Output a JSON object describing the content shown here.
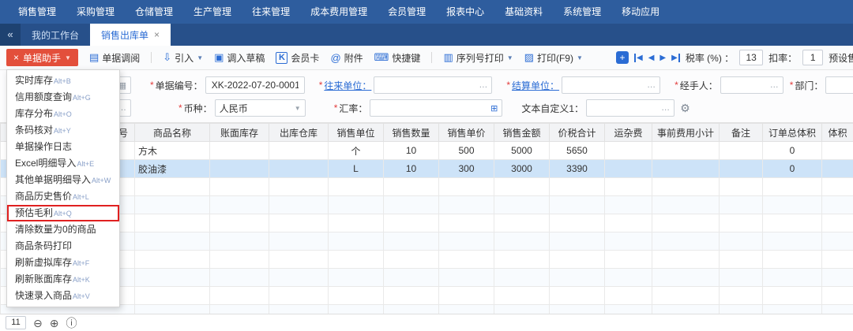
{
  "colors": {
    "navbar": "#2e5d9e",
    "tabbar": "#27508a",
    "accent_red": "#e34f3b",
    "link_blue": "#2b6cd4",
    "selected_row": "#cde3f8",
    "highlight_red": "#e02020"
  },
  "icons": {
    "back-icon": "«",
    "close-icon": "×",
    "caret-down-icon": "▼",
    "assistant-icon": "×",
    "doc-view-icon": "▤",
    "import-icon": "⇩",
    "draft-icon": "▣",
    "member-card-icon": "K",
    "attachment-icon": "@",
    "hotkey-icon": "⌨",
    "serial-print-icon": "▥",
    "print-icon": "▨",
    "add-icon": "+",
    "first-page-icon": "◀",
    "prev-icon": "◀",
    "next-icon": "▶",
    "last-page-icon": "▶",
    "calendar-icon": "▦",
    "ellipsis-icon": "…",
    "exrate-grid-icon": "⊞",
    "gear-icon": "⚙",
    "minus-circle-icon": "⊖",
    "plus-circle-icon": "⊕",
    "info-circle-icon": "ⓘ"
  },
  "nav": {
    "items": [
      "销售管理",
      "采购管理",
      "仓储管理",
      "生产管理",
      "往来管理",
      "成本费用管理",
      "会员管理",
      "报表中心",
      "基础资料",
      "系统管理",
      "移动应用"
    ]
  },
  "tabs": {
    "items": [
      {
        "label": "我的工作台",
        "active": false,
        "closable": false
      },
      {
        "label": "销售出库单",
        "active": true,
        "closable": true
      }
    ]
  },
  "toolbar": {
    "assistant_label": "单据助手",
    "buttons": [
      {
        "label": "单据调阅",
        "icon": "doc-view-icon",
        "caret": false
      },
      {
        "label": "引入",
        "icon": "import-icon",
        "caret": true
      },
      {
        "label": "调入草稿",
        "icon": "draft-icon",
        "caret": false
      },
      {
        "label": "会员卡",
        "icon": "member-card-icon",
        "caret": false
      },
      {
        "label": "附件",
        "icon": "attachment-icon",
        "caret": false
      },
      {
        "label": "快捷键",
        "icon": "hotkey-icon",
        "caret": false
      },
      {
        "label": "序列号打印",
        "icon": "serial-print-icon",
        "caret": true
      },
      {
        "label": "打印(F9)",
        "icon": "print-icon",
        "caret": true
      }
    ],
    "tax_rate_label": "税率 (%) ：",
    "tax_rate_value": "13",
    "discount_rate_label": "扣率：",
    "discount_rate_value": "1",
    "preset_price_label": "预设售价"
  },
  "form": {
    "required_marker": "*",
    "date": {
      "value": ""
    },
    "doc_no": {
      "label": "单据编号：",
      "value": "XK-2022-07-20-0001"
    },
    "partner": {
      "label": "往来单位：",
      "value": ""
    },
    "settle": {
      "label": "结算单位：",
      "value": ""
    },
    "handler": {
      "label": "经手人：",
      "value": ""
    },
    "dept": {
      "label": "部门：",
      "value": ""
    },
    "row2_field": {
      "value": ""
    },
    "currency": {
      "label": "币种：",
      "value": "人民币"
    },
    "exchange_rate": {
      "label": "汇率：",
      "value": ""
    },
    "custom_text1": {
      "label": "文本自定义1：",
      "value": ""
    }
  },
  "menu": {
    "items": [
      {
        "label": "实时库存",
        "shortcut": "Alt+B",
        "highlighted": false
      },
      {
        "label": "信用额度查询",
        "shortcut": "Alt+G",
        "highlighted": false
      },
      {
        "label": "库存分布",
        "shortcut": "Alt+O",
        "highlighted": false
      },
      {
        "label": "条码核对",
        "shortcut": "Alt+Y",
        "highlighted": false
      },
      {
        "label": "单据操作日志",
        "shortcut": "",
        "highlighted": false
      },
      {
        "label": "Excel明细导入",
        "shortcut": "Alt+E",
        "highlighted": false
      },
      {
        "label": "其他单据明细导入",
        "shortcut": "Alt+W",
        "highlighted": false
      },
      {
        "label": "商品历史售价",
        "shortcut": "Alt+L",
        "highlighted": false
      },
      {
        "label": "预估毛利",
        "shortcut": "Alt+Q",
        "highlighted": true
      },
      {
        "label": "清除数量为0的商品",
        "shortcut": "",
        "highlighted": false
      },
      {
        "label": "商品条码打印",
        "shortcut": "",
        "highlighted": false
      },
      {
        "label": "刷新虚拟库存",
        "shortcut": "Alt+F",
        "highlighted": false
      },
      {
        "label": "刷新账面库存",
        "shortcut": "Alt+K",
        "highlighted": false
      },
      {
        "label": "快速录入商品",
        "shortcut": "Alt+V",
        "highlighted": false
      }
    ]
  },
  "table": {
    "headers": [
      "号",
      "商品名称",
      "账面库存",
      "出库仓库",
      "销售单位",
      "销售数量",
      "销售单价",
      "销售金额",
      "价税合计",
      "运杂费",
      "事前费用小计",
      "备注",
      "订单总体积",
      "体积"
    ],
    "rows": [
      [
        "",
        "方木",
        "",
        "",
        "个",
        "10",
        "500",
        "5000",
        "5650",
        "",
        "",
        "",
        "0",
        ""
      ],
      [
        "",
        "胶油漆",
        "",
        "",
        "L",
        "10",
        "300",
        "3000",
        "3390",
        "",
        "",
        "",
        "0",
        ""
      ]
    ],
    "selected_row_index": 1,
    "empty_row_count": 8
  },
  "footer": {
    "row_count": "11"
  }
}
